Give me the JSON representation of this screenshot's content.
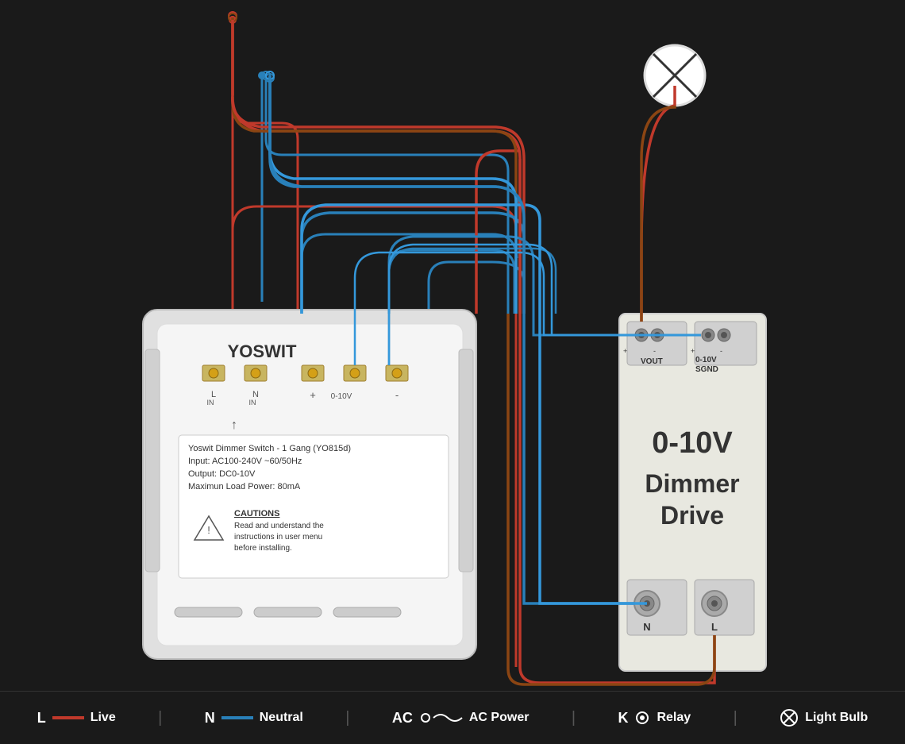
{
  "legend": {
    "items": [
      {
        "id": "live",
        "label_prefix": "L",
        "label": "Live",
        "color": "#c0392b",
        "type": "line"
      },
      {
        "id": "neutral",
        "label_prefix": "N",
        "label": "Neutral",
        "color": "#2980b9",
        "type": "line"
      },
      {
        "id": "ac_power",
        "label_prefix": "AC",
        "label": "AC Power",
        "color": "#555",
        "type": "ac"
      },
      {
        "id": "relay",
        "label_prefix": "K",
        "label": "Relay",
        "color": "#555",
        "type": "dot"
      },
      {
        "id": "light_bulb",
        "label_prefix": "",
        "label": "Light Bulb",
        "color": "#fff",
        "type": "bulb"
      }
    ]
  },
  "switch": {
    "brand": "YOSWIT",
    "model": "Yoswit Dimmer Switch - 1 Gang (YO815d)",
    "input": "Input: AC100-240V ~60/50Hz",
    "output": "Output: DC0-10V",
    "max_load": "Maximun Load Power: 80mA",
    "caution_title": "CAUTIONS",
    "caution_text": "Read and understand the instructions in user menu before installing.",
    "terminals": [
      "L_IN",
      "N_IN",
      "+",
      "0-10V",
      "-"
    ]
  },
  "driver": {
    "title": "0-10V",
    "subtitle": "Dimmer",
    "subtitle2": "Drive",
    "vout_label": "VOUT",
    "sgnd_label": "0-10V\nSGND",
    "n_label": "N",
    "l_label": "L"
  },
  "colors": {
    "background": "#1a1a1a",
    "live_wire": "#c0392b",
    "neutral_wire": "#2980b9",
    "device_body": "#e8e8e8",
    "text_dark": "#333",
    "text_white": "#ffffff"
  }
}
